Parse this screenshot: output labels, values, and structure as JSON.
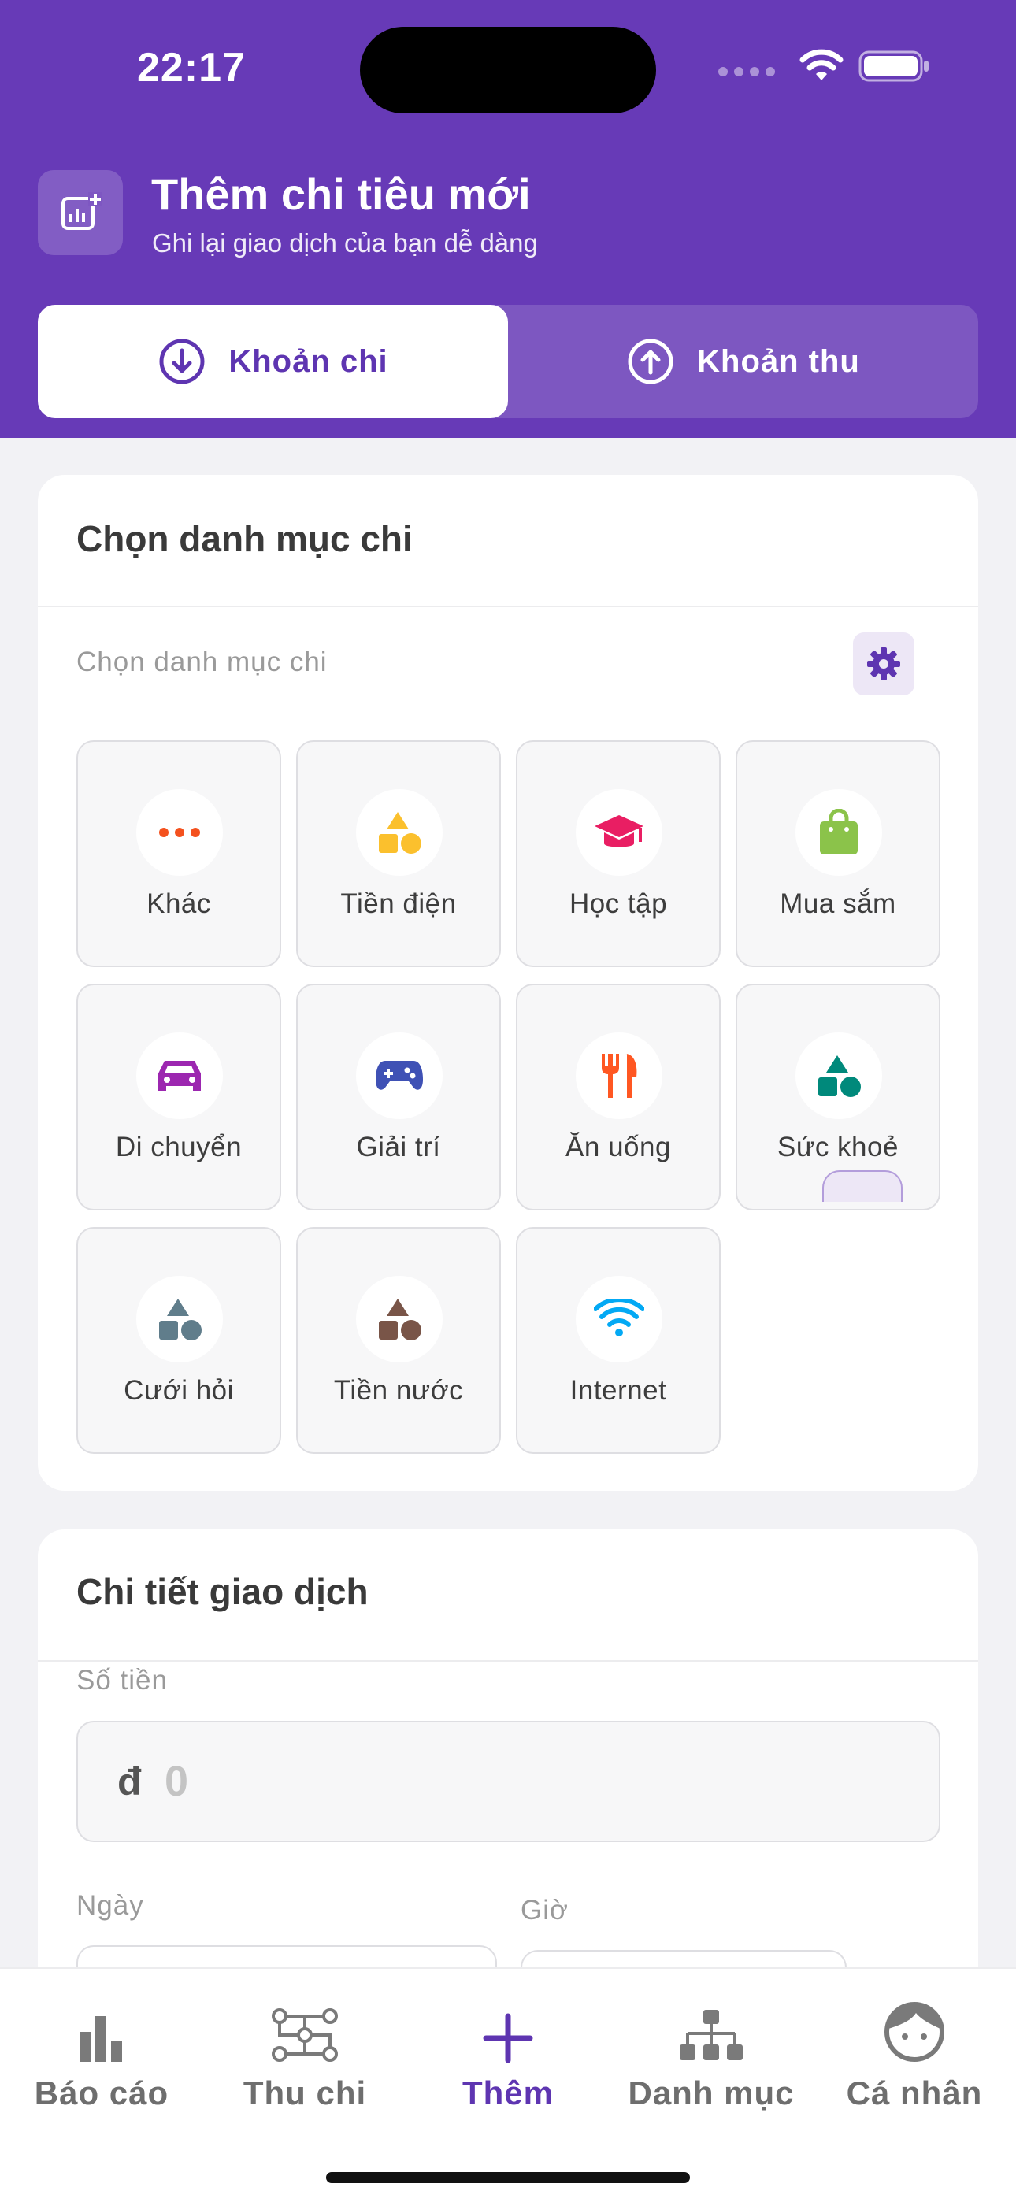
{
  "status_bar": {
    "time": "22:17"
  },
  "header": {
    "title": "Thêm chi tiêu mới",
    "subtitle": "Ghi lại giao dịch của bạn dễ dàng",
    "icon": "chart-add-icon"
  },
  "segment": {
    "expense": {
      "label": "Khoản chi",
      "icon": "arrow-down-circle-icon",
      "selected": true
    },
    "income": {
      "label": "Khoản thu",
      "icon": "arrow-up-circle-icon",
      "selected": false
    }
  },
  "category_card": {
    "title": "Chọn danh mục chi",
    "hint": "Chọn danh mục chi",
    "categories": [
      {
        "label": "Khác",
        "icon": "more-dots-icon",
        "color": "#f4511e"
      },
      {
        "label": "Tiền điện",
        "icon": "shapes-icon",
        "color": "#fbc02d"
      },
      {
        "label": "Học tập",
        "icon": "graduation-cap-icon",
        "color": "#e91e63"
      },
      {
        "label": "Mua sắm",
        "icon": "shopping-bag-icon",
        "color": "#8bc34a"
      },
      {
        "label": "Di chuyển",
        "icon": "car-icon",
        "color": "#9c27b0"
      },
      {
        "label": "Giải trí",
        "icon": "gamepad-icon",
        "color": "#3f51b5"
      },
      {
        "label": "Ăn uống",
        "icon": "fork-knife-icon",
        "color": "#ff5722"
      },
      {
        "label": "Sức khoẻ",
        "icon": "shapes-icon",
        "color": "#00897b"
      },
      {
        "label": "Cưới hỏi",
        "icon": "shapes-icon",
        "color": "#607d8b"
      },
      {
        "label": "Tiền nước",
        "icon": "shapes-icon",
        "color": "#795548"
      },
      {
        "label": "Internet",
        "icon": "wifi-icon",
        "color": "#03a9f4"
      }
    ]
  },
  "detail_card": {
    "title": "Chi tiết giao dịch",
    "amount_label": "Số tiền",
    "currency_symbol": "đ",
    "amount_placeholder": "0",
    "date_label": "Ngày",
    "time_label": "Giờ"
  },
  "tabbar": {
    "items": [
      {
        "label": "Báo cáo",
        "icon": "bar-chart-icon",
        "active": false
      },
      {
        "label": "Thu chi",
        "icon": "flow-nodes-icon",
        "active": false
      },
      {
        "label": "Thêm",
        "icon": "plus-icon",
        "active": true
      },
      {
        "label": "Danh mục",
        "icon": "hierarchy-icon",
        "active": false
      },
      {
        "label": "Cá nhân",
        "icon": "face-icon",
        "active": false
      }
    ]
  },
  "colors": {
    "primary": "#673ab7",
    "accent": "#5e35b1",
    "card_bg": "#ffffff",
    "page_bg": "#f2f2f5"
  }
}
